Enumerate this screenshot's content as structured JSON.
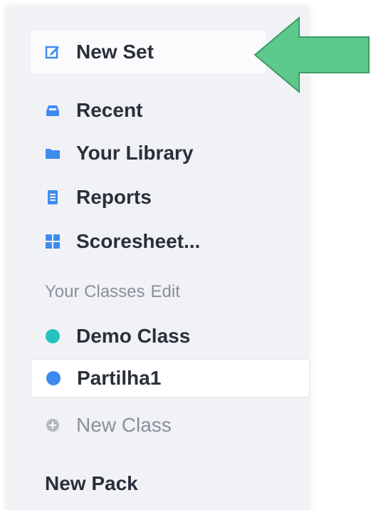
{
  "sidebar": {
    "new_set": {
      "label": "New Set",
      "icon": "edit-icon"
    },
    "nav": {
      "recent": {
        "label": "Recent",
        "icon": "inbox-icon"
      },
      "library": {
        "label": "Your Library",
        "icon": "folder-icon"
      },
      "reports": {
        "label": "Reports",
        "icon": "document-icon"
      },
      "scoresheet": {
        "label": "Scoresheet...",
        "icon": "grid-icon"
      }
    },
    "classes_header": {
      "title": "Your Classes",
      "edit": "Edit"
    },
    "classes": [
      {
        "label": "Demo Class",
        "dot_color": "#25c2c0"
      },
      {
        "label": "Partilha1",
        "dot_color": "#3e8bf0",
        "selected": true
      }
    ],
    "new_class": {
      "label": "New Class",
      "icon": "plus-circle-icon"
    },
    "new_pack": {
      "label": "New Pack"
    }
  },
  "annotation": {
    "arrow_color": "#5ec98c",
    "arrow_icon": "arrow-left-icon"
  },
  "colors": {
    "accent": "#3e8bf0",
    "sidebar_bg": "#f1f2f6",
    "text": "#2b2f3a"
  }
}
